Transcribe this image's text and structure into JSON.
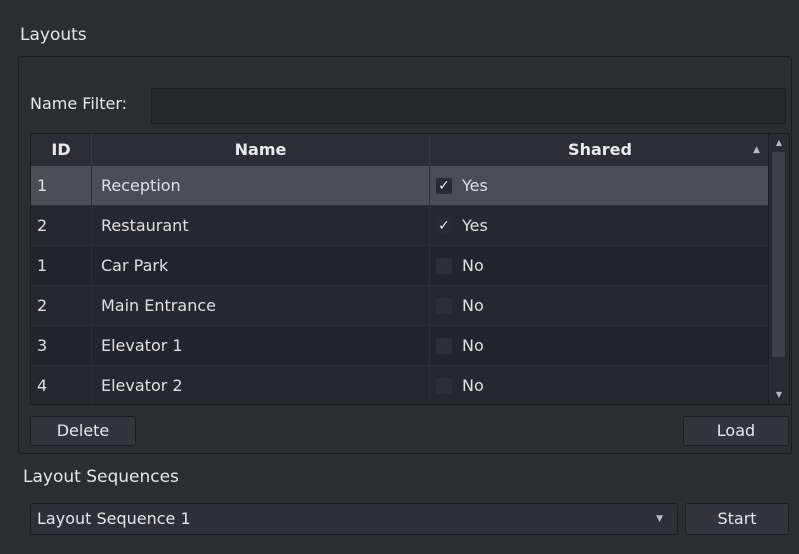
{
  "layouts_group": {
    "title": "Layouts",
    "filter_label": "Name Filter:",
    "filter_value": "",
    "columns": {
      "id": "ID",
      "name": "Name",
      "shared": "Shared"
    },
    "rows": [
      {
        "id": "1",
        "name": "Reception",
        "checked": true,
        "shared": "Yes",
        "selected": true
      },
      {
        "id": "2",
        "name": "Restaurant",
        "checked": true,
        "shared": "Yes",
        "selected": false
      },
      {
        "id": "1",
        "name": "Car Park",
        "checked": false,
        "shared": "No",
        "selected": false
      },
      {
        "id": "2",
        "name": "Main Entrance",
        "checked": false,
        "shared": "No",
        "selected": false
      },
      {
        "id": "3",
        "name": "Elevator 1",
        "checked": false,
        "shared": "No",
        "selected": false
      },
      {
        "id": "4",
        "name": "Elevator 2",
        "checked": false,
        "shared": "No",
        "selected": false
      }
    ],
    "delete_label": "Delete",
    "load_label": "Load"
  },
  "sequences_group": {
    "title": "Layout Sequences",
    "selected_sequence": "Layout Sequence 1",
    "start_label": "Start"
  },
  "icons": {
    "sort": "sort-ascending-icon",
    "check": "checkmark-icon",
    "dropdown": "chevron-down-icon"
  },
  "colors": {
    "background": "#2b2d31",
    "selected_row": "#4b4e56",
    "text": "#dcdde0"
  }
}
